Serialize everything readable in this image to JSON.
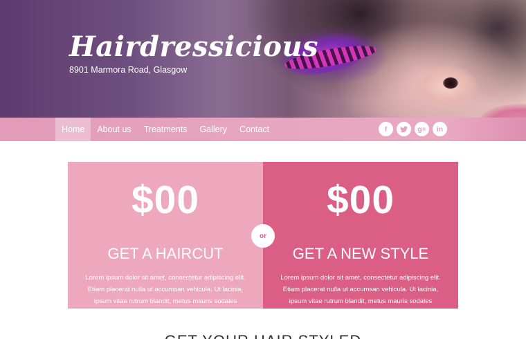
{
  "brand": {
    "name": "Hairdressicious",
    "address": "8901 Marmora Road, Glasgow"
  },
  "nav": {
    "items": [
      "Home",
      "About us",
      "Treatments",
      "Gallery",
      "Contact"
    ],
    "active": "Home"
  },
  "social": {
    "icons": [
      {
        "name": "facebook-icon",
        "glyph": "f"
      },
      {
        "name": "twitter-icon",
        "glyph": "t"
      },
      {
        "name": "google-plus-icon",
        "glyph": "g+"
      },
      {
        "name": "linkedin-icon",
        "glyph": "in"
      }
    ]
  },
  "pricing": {
    "or_label": "or",
    "cards": [
      {
        "price": "$00",
        "title": "GET A HAIRCUT",
        "description": "Lorem ipsum dolor sit amet, consectetur adipiscing elit. Etiam placerat nulla ut accumsan vehicula. Ut lacinia, ipsum vitae rutrum blandit, metus mauris sodales",
        "color": "#eea8bd"
      },
      {
        "price": "$00",
        "title": "GET A NEW STYLE",
        "description": "Lorem ipsum dolor sit amet, consectetur adipiscing elit. Etiam placerat nulla ut accumsan vehicula. Ut lacinia, ipsum vitae rutrum blandit, metus mauris sodales",
        "color": "#db5e84"
      }
    ]
  },
  "section": {
    "heading": "GET YOUR HAIR STYLED"
  }
}
